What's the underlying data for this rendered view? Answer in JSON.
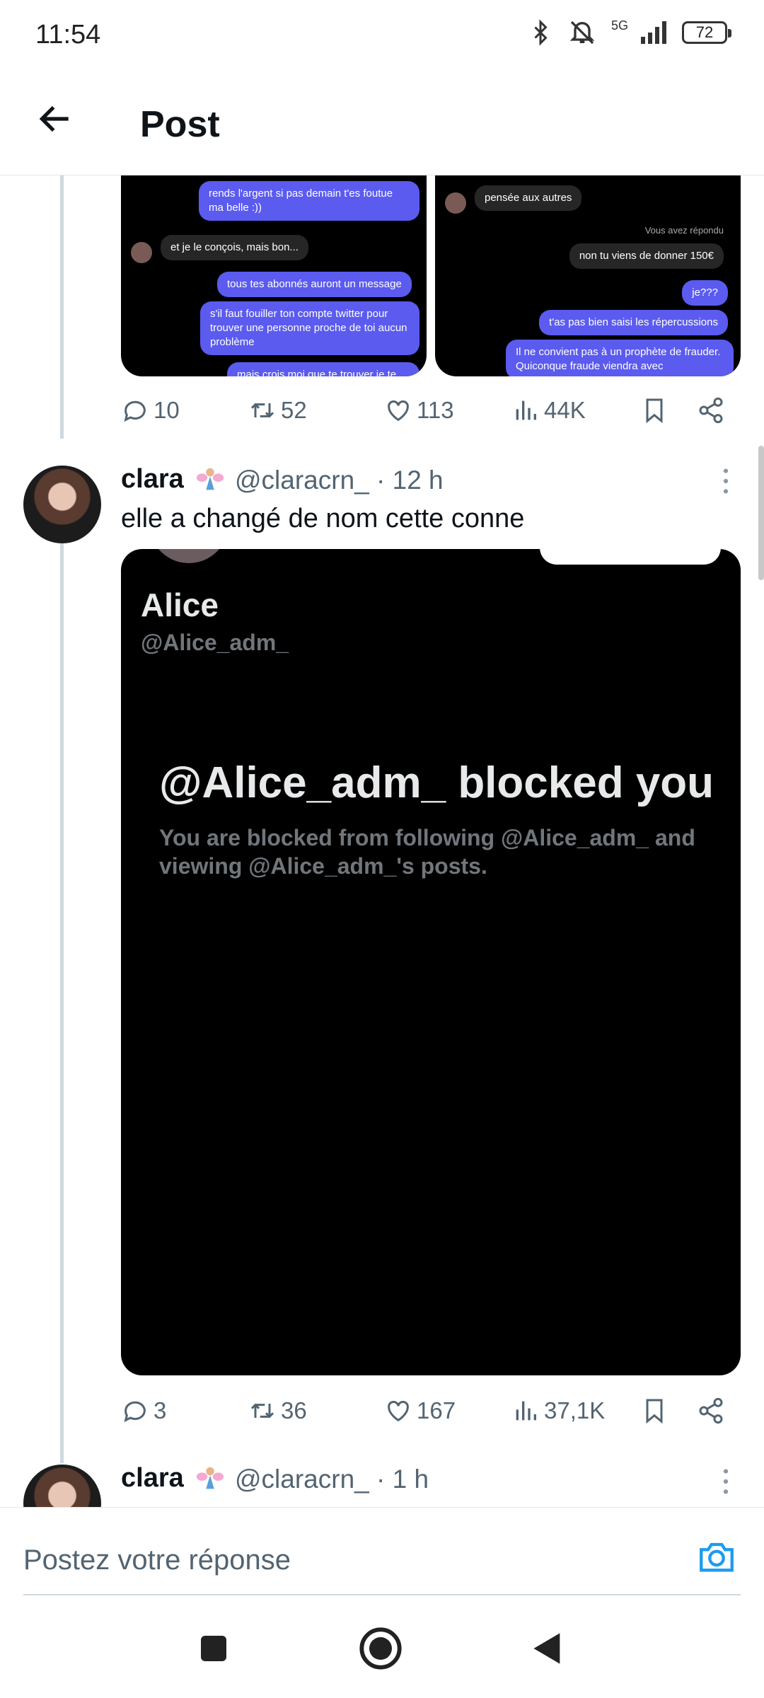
{
  "status": {
    "time": "11:54",
    "network": "5G",
    "battery": "72"
  },
  "header": {
    "title": "Post"
  },
  "screenshots": {
    "left": {
      "bubbles": [
        "rends l'argent si pas demain t'es foutue ma belle :))",
        "et je le conçois, mais bon...",
        "tous tes abonnés auront un message",
        "s'il faut fouiller ton compte twitter pour trouver une personne proche de toi aucun problème",
        "mais crois moi que te trouver je te"
      ]
    },
    "right": {
      "bubbles": [
        "pensée aux autres",
        "non tu viens de donner 150€",
        "je???",
        "t'as pas bien saisi les répercussions",
        "Il ne convient pas à un prophète de frauder. Quiconque fraude viendra avec"
      ],
      "system": "Vous avez répondu"
    }
  },
  "tweet1_actions": {
    "replies": "10",
    "retweets": "52",
    "likes": "113",
    "views": "44K"
  },
  "tweet2": {
    "name": "clara",
    "handle": "@claracrn_ · 12 h",
    "text": "elle a changé de nom cette conne",
    "media": {
      "profile_name": "Alice",
      "profile_handle": "@Alice_adm_",
      "blocked_title": "@Alice_adm_ blocked you",
      "blocked_sub": "You are blocked from following @Alice_adm_ and viewing @Alice_adm_'s posts."
    },
    "actions": {
      "replies": "3",
      "retweets": "36",
      "likes": "167",
      "views": "37,1K"
    }
  },
  "tweet3": {
    "name": "clara",
    "handle": "@claracrn_ · 1 h"
  },
  "reply": {
    "placeholder": "Postez votre réponse"
  },
  "colors": {
    "accent": "#1d9bf0",
    "chat_me": "#5b5bef",
    "thread_line": "#cfd9de"
  }
}
